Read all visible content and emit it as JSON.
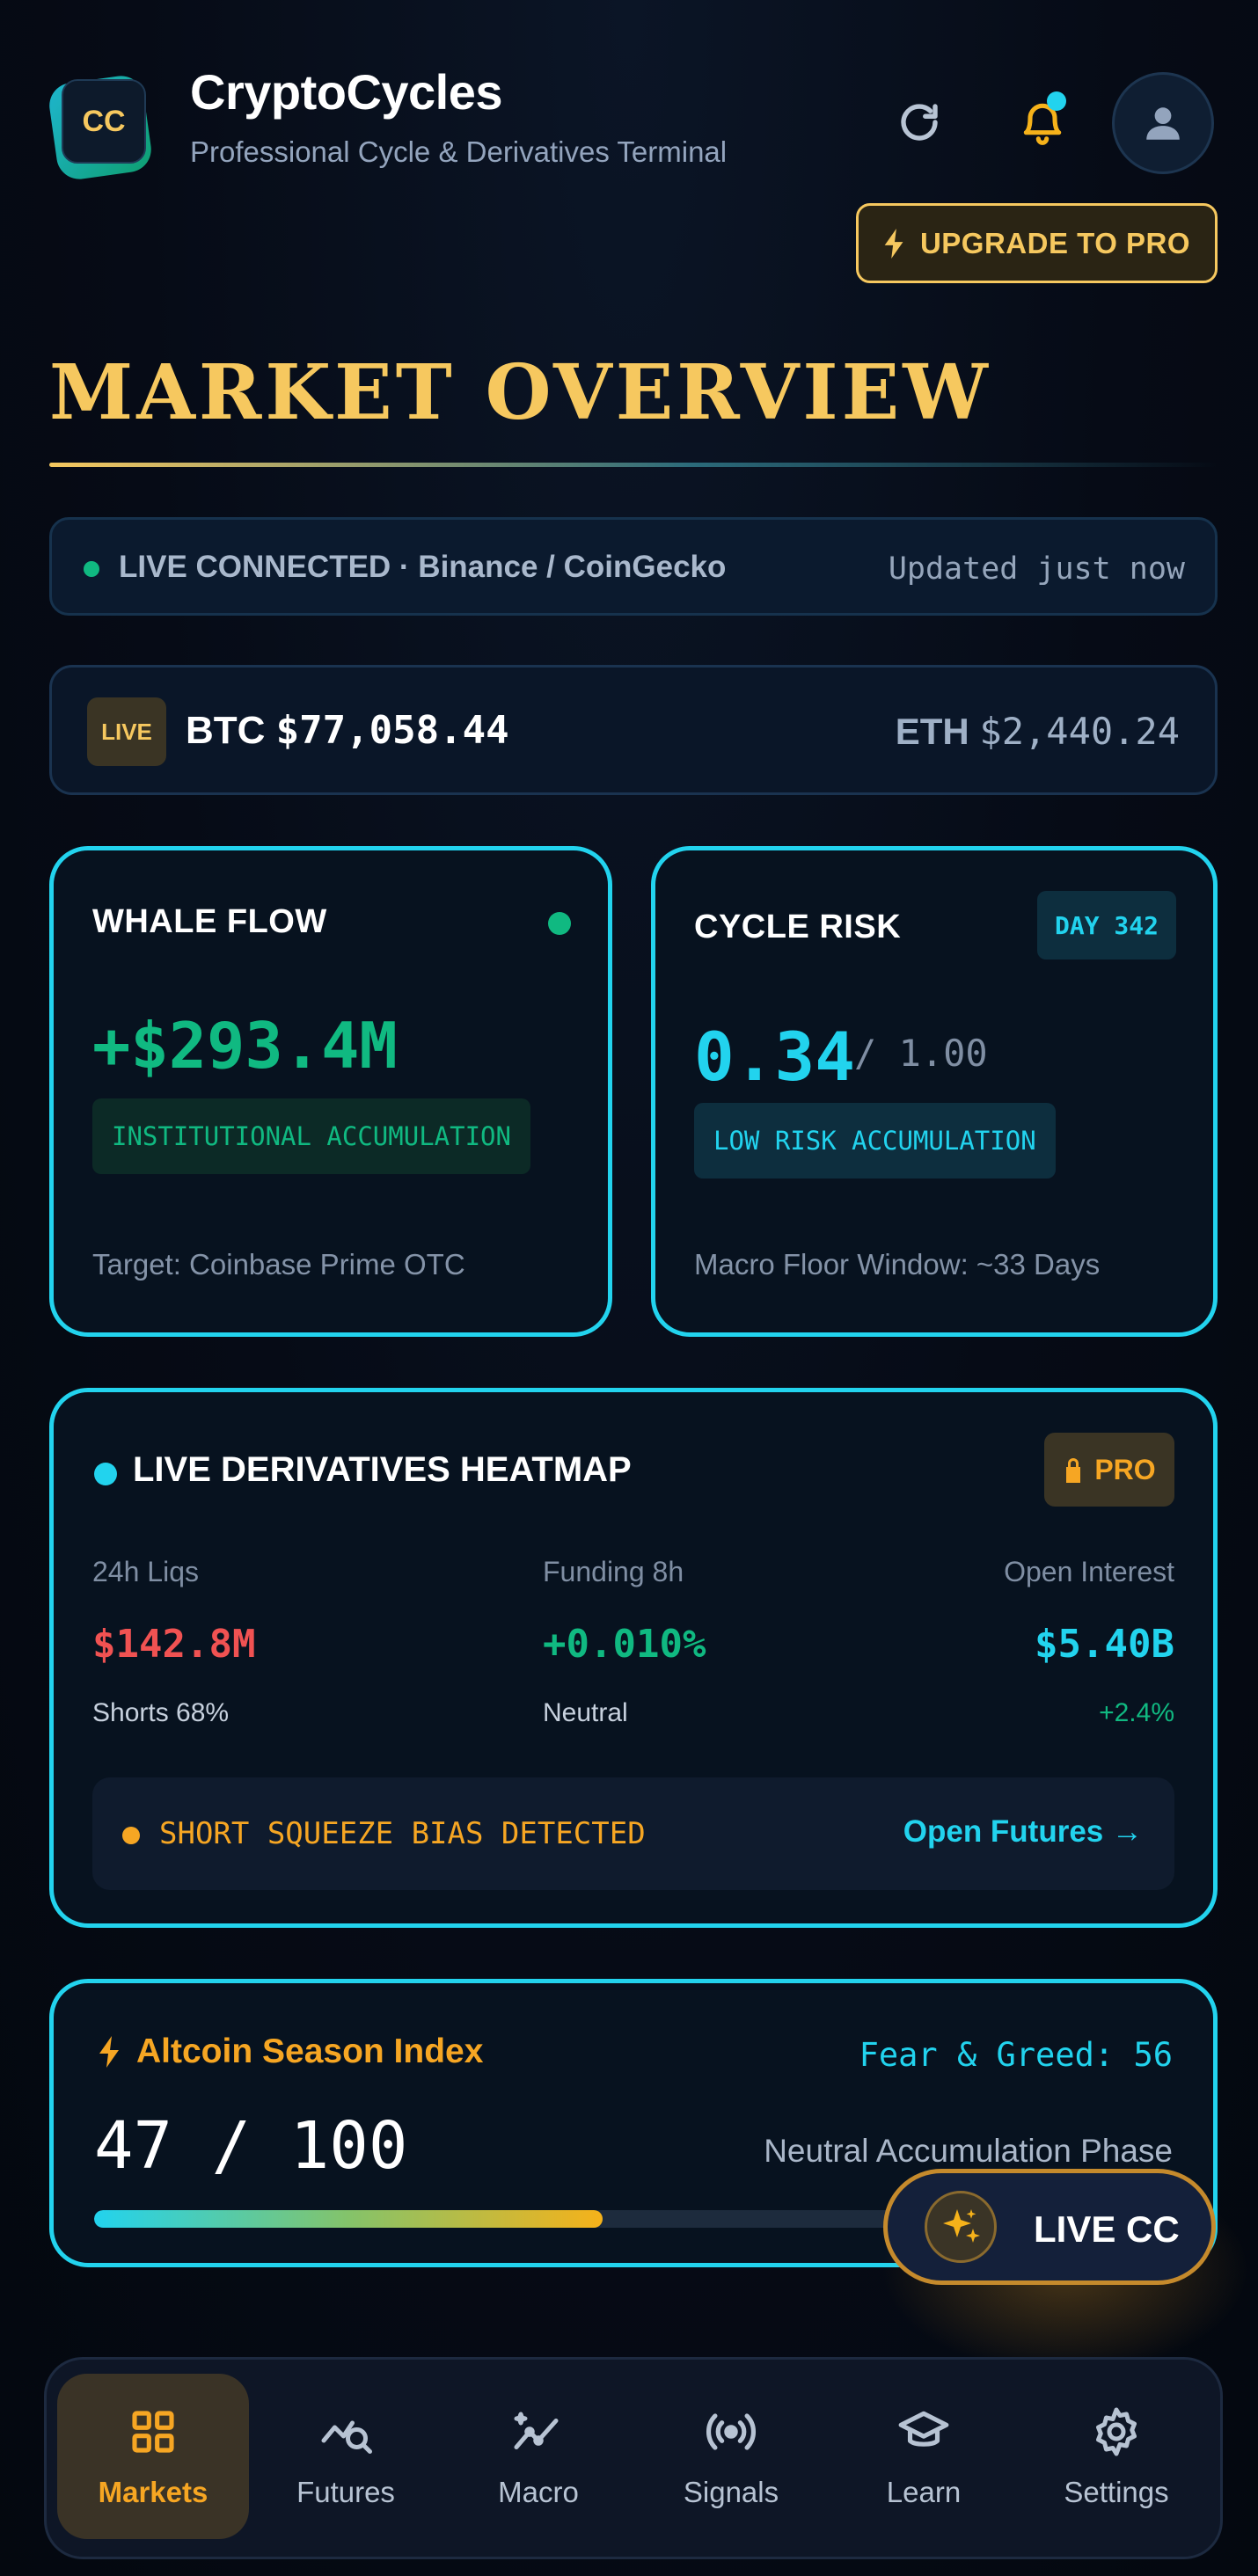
{
  "app": {
    "logo_text": "CC",
    "title": "CryptoCycles",
    "subtitle": "Professional Cycle & Derivatives Terminal",
    "upgrade_label": "UPGRADE TO PRO"
  },
  "section": {
    "title": "MARKET OVERVIEW"
  },
  "connection": {
    "status": "LIVE CONNECTED · Binance / CoinGecko",
    "updated": "Updated just now"
  },
  "ticker": {
    "live_label": "LIVE",
    "btc_symbol": "BTC",
    "btc_price": "$77,058.44",
    "eth_symbol": "ETH",
    "eth_price": "$2,440.24"
  },
  "whale": {
    "title": "WHALE FLOW",
    "value": "+$293.4M",
    "tag": "INSTITUTIONAL ACCUMULATION",
    "footer": "Target: Coinbase Prime OTC"
  },
  "risk": {
    "title": "CYCLE RISK",
    "day": "DAY 342",
    "value": "0.34",
    "max": "/ 1.00",
    "tag": "LOW RISK ACCUMULATION",
    "footer": "Macro Floor Window: ~33 Days"
  },
  "heatmap": {
    "title": "LIVE DERIVATIVES HEATMAP",
    "pro_label": "PRO",
    "stats": [
      {
        "label": "24h Liqs",
        "value": "$142.8M",
        "sub": "Shorts 68%",
        "color": "#f05252",
        "sub_color": "#c7d1de"
      },
      {
        "label": "Funding 8h",
        "value": "+0.010%",
        "sub": "Neutral",
        "color": "#10b981",
        "sub_color": "#c7d1de"
      },
      {
        "label": "Open Interest",
        "value": "$5.40B",
        "sub": "+2.4%",
        "color": "#22d3ee",
        "sub_color": "#10b981"
      }
    ],
    "bias": "SHORT SQUEEZE BIAS DETECTED",
    "link": "Open Futures →"
  },
  "altseason": {
    "title": "Altcoin Season Index",
    "fear_greed": "Fear & Greed: 56",
    "value": "47 / 100",
    "phase": "Neutral Accumulation Phase",
    "progress": 0.47
  },
  "live_button": {
    "label": "LIVE CC"
  },
  "nav": [
    {
      "label": "Markets",
      "icon": "grid-icon",
      "active": true
    },
    {
      "label": "Futures",
      "icon": "chart-search-icon",
      "active": false
    },
    {
      "label": "Macro",
      "icon": "trend-sparkle-icon",
      "active": false
    },
    {
      "label": "Signals",
      "icon": "broadcast-icon",
      "active": false
    },
    {
      "label": "Learn",
      "icon": "graduation-cap-icon",
      "active": false
    },
    {
      "label": "Settings",
      "icon": "gear-icon",
      "active": false
    }
  ],
  "colors": {
    "accent": "#22d3ee",
    "gold": "#f6c85f",
    "amber": "#f6a623",
    "green": "#10b981",
    "red": "#f05252"
  }
}
